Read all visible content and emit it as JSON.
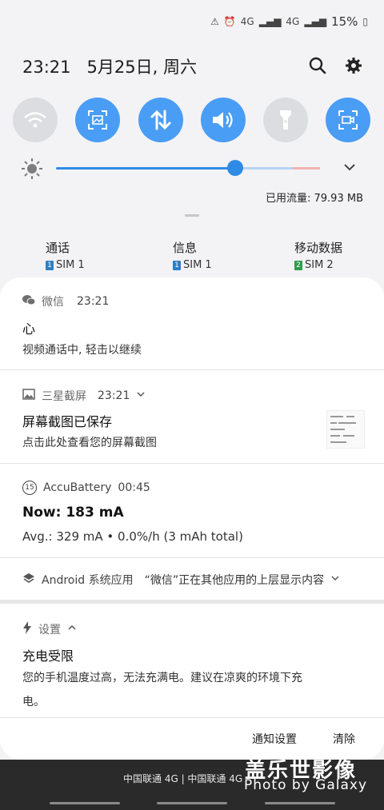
{
  "status_bar": {
    "network_4g_1": "4G",
    "network_4g_2": "4G",
    "battery": "15%"
  },
  "header": {
    "datetime": "23:21   5月25日, 周六"
  },
  "quick_toggles": [
    {
      "name": "wifi",
      "on": false
    },
    {
      "name": "screenshot",
      "on": true
    },
    {
      "name": "mobile-data",
      "on": true
    },
    {
      "name": "sound",
      "on": true
    },
    {
      "name": "flashlight",
      "on": false
    },
    {
      "name": "screen-record",
      "on": true
    }
  ],
  "brightness": {
    "level": 0.68
  },
  "data_usage": "已用流量: 79.93 MB",
  "sim_prefs": [
    {
      "label": "通话",
      "sim": "SIM 1",
      "num": "1"
    },
    {
      "label": "信息",
      "sim": "SIM 1",
      "num": "1"
    },
    {
      "label": "移动数据",
      "sim": "SIM 2",
      "num": "2"
    }
  ],
  "notifications": {
    "wechat": {
      "app": "微信",
      "time": "23:21",
      "title": "心",
      "body": "视频通话中, 轻击以继续"
    },
    "screenshot": {
      "app": "三星截屏",
      "time": "23:21",
      "title": "屏幕截图已保存",
      "body": "点击此处查看您的屏幕截图"
    },
    "accubattery": {
      "app": "AccuBattery",
      "time": "00:45",
      "badge": "15",
      "title": "Now: 183 mA",
      "body": "Avg.: 329 mA • 0.0%/h (3 mAh total)"
    },
    "android": {
      "app": "Android 系统应用",
      "body": "“微信”正在其他应用的上层显示内容"
    },
    "settings": {
      "app": "设置",
      "title": "充电受限",
      "body_line1": "您的手机温度过高，无法充满电。建议在凉爽的环境下充",
      "body_line2": "电。"
    }
  },
  "footer_buttons": {
    "settings": "通知设置",
    "clear": "清除"
  },
  "bottom": {
    "carrier": "中国联通 4G | 中国联通 4G",
    "watermark_cn": "盖乐世影像",
    "watermark_en": "Photo by Galaxy"
  },
  "colors": {
    "accent": "#4a9df4",
    "slider": "#2f8be6",
    "wechat_green": "#07c160"
  }
}
